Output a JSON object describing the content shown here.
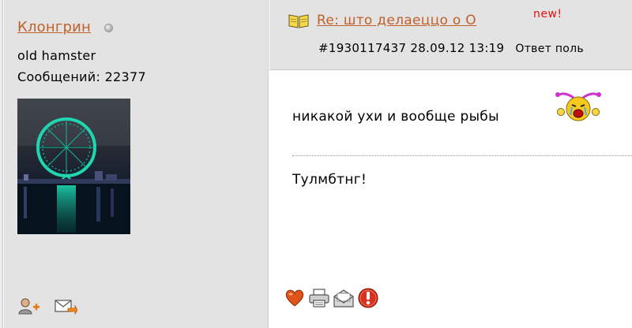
{
  "user": {
    "name": "Клонгрин",
    "title": "old hamster",
    "post_count": "Сообщений: 22377"
  },
  "post": {
    "subject": "Re: што делаеццо о  О",
    "new_badge": "new!",
    "meta": "#1930117437 28.09.12 13:19",
    "reply_label": "Ответ поль",
    "text": "никакой ухи и вообще рыбы",
    "signature": "Тулмбтнг!"
  },
  "icons": {
    "status": "offline-dot-icon",
    "add_friend": "add-user-icon",
    "message": "send-message-icon",
    "topic": "open-book-icon",
    "smiley": "crying-smiley-icon",
    "like": "heart-icon",
    "print": "printer-icon",
    "mail": "envelope-icon",
    "report": "alert-icon"
  },
  "colors": {
    "link": "#c0602a",
    "new_badge": "#e01010",
    "panel_bg": "#e3e3e3"
  }
}
